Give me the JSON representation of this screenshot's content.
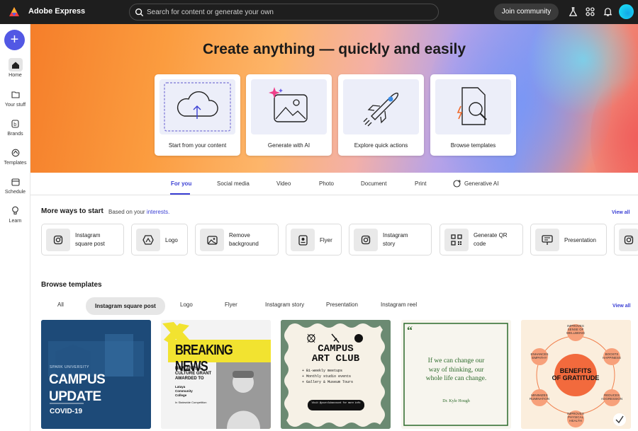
{
  "topbar": {
    "app_name": "Adobe Express",
    "search_placeholder": "Search for content or generate your own",
    "join_label": "Join community",
    "icons": [
      "flask-icon",
      "apps-grid-icon",
      "bell-icon",
      "avatar"
    ]
  },
  "rail": {
    "create_label": "+",
    "items": [
      {
        "label": "Home",
        "icon": "home-icon",
        "active": true
      },
      {
        "label": "Your stuff",
        "icon": "folder-icon"
      },
      {
        "label": "Brands",
        "icon": "brand-icon"
      },
      {
        "label": "Templates",
        "icon": "templates-icon"
      },
      {
        "label": "Schedule",
        "icon": "calendar-icon"
      },
      {
        "label": "Learn",
        "icon": "lightbulb-icon"
      }
    ]
  },
  "hero": {
    "title": "Create anything — quickly and easily",
    "cards": [
      {
        "label": "Start from your content",
        "icon": "cloud-upload-icon"
      },
      {
        "label": "Generate with AI",
        "icon": "ai-image-icon"
      },
      {
        "label": "Explore quick actions",
        "icon": "rocket-icon"
      },
      {
        "label": "Browse templates",
        "icon": "search-templates-icon"
      }
    ]
  },
  "tabs": [
    {
      "label": "For you",
      "active": true
    },
    {
      "label": "Social media"
    },
    {
      "label": "Video"
    },
    {
      "label": "Photo"
    },
    {
      "label": "Document"
    },
    {
      "label": "Print"
    },
    {
      "label": "Generative AI"
    }
  ],
  "more_ways": {
    "title": "More ways to start",
    "subtitle_prefix": "Based on your",
    "subtitle_link": "interests.",
    "view_all": "View all",
    "items": [
      {
        "line1": "Instagram",
        "line2": "square post",
        "icon": "instagram-icon"
      },
      {
        "line1": "Logo",
        "line2": "",
        "icon": "logo-icon"
      },
      {
        "line1": "Remove",
        "line2": "background",
        "icon": "image-icon"
      },
      {
        "line1": "Flyer",
        "line2": "",
        "icon": "flyer-icon"
      },
      {
        "line1": "Instagram",
        "line2": "story",
        "icon": "instagram-icon"
      },
      {
        "line1": "Generate QR",
        "line2": "code",
        "icon": "qr-code-icon"
      },
      {
        "line1": "Presentation",
        "line2": "",
        "icon": "presentation-icon"
      }
    ]
  },
  "browse": {
    "title": "Browse templates",
    "view_all": "View all",
    "filters": [
      "All",
      "Instagram square post",
      "Logo",
      "Flyer",
      "Instagram story",
      "Presentation",
      "Instagram reel"
    ],
    "templates": [
      {
        "small": "SPARK UNIVERSITY",
        "title1": "CAMPUS",
        "title2": "UPDATE",
        "sub": "COVID-19",
        "bg": "#1d4a78"
      },
      {
        "headline": "BREAKING NEWS",
        "line1": "NEW ARTS &",
        "line2": "CULTURE GRANT",
        "line3": "AWARDED TO",
        "org1": "Lataya",
        "org2": "Community",
        "org3": "College",
        "foot": "In Statewide Competition"
      },
      {
        "title1": "CAMPUS",
        "title2": "ART CLUB",
        "b1": "+ Bi-weekly meetups",
        "b2": "+ Monthly studio events",
        "b3": "+ Gallery & Museum Tours",
        "cta": "Visit @yourclubaccount for more info"
      },
      {
        "q1": "If we can change our",
        "q2": "way of thinking, our",
        "q3": "whole life can change.",
        "author": "Dr. Kyle Hough"
      },
      {
        "center1": "BENEFITS",
        "center2": "OF GRATITUDE",
        "n_top1": "IMPROVES",
        "n_top2": "SENSE OF",
        "n_top3": "WELLBEING",
        "n_l1": "ENHANCES",
        "n_l2": "EMPATHY",
        "n_r1": "BOOSTS",
        "n_r2": "HAPPINESS",
        "n_bl1": "MINIMIZES",
        "n_bl2": "RUMINATION",
        "n_br1": "REDUCES",
        "n_br2": "AGGRESSION",
        "n_b1": "IMPROVES",
        "n_b2": "PHYSICAL",
        "n_b3": "HEALTH"
      }
    ]
  },
  "colors": {
    "accent": "#3a3fd4",
    "create": "#5258e4",
    "topbar": "#1e1e1e"
  }
}
